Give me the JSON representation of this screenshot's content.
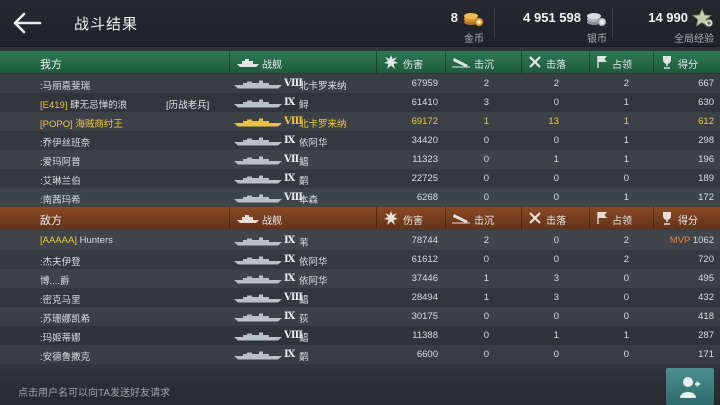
{
  "header": {
    "title": "战斗结果",
    "gold": {
      "amount": "8",
      "label": "金币"
    },
    "silver": {
      "amount": "4 951 598",
      "label": "银币"
    },
    "xp": {
      "amount": "14 990",
      "label": "全局经验"
    }
  },
  "columns": {
    "ship": "战舰",
    "damage": "伤害",
    "sunk": "击沉",
    "downed": "击落",
    "capture": "占领",
    "score": "得分"
  },
  "our_team": {
    "name": "我方",
    "rows": [
      {
        "tag": "",
        "player": ":马丽嘉斐瑞",
        "badge": "",
        "tier": "Ⅷ",
        "ship": "北卡罗来纳",
        "damage": "67959",
        "sunk": "2",
        "downed": "2",
        "capture": "2",
        "score": "667",
        "me": false
      },
      {
        "tag": "[E419]",
        "player": " 肆无忌惮的浪",
        "badge": "[历战老兵]",
        "tier": "Ⅸ",
        "ship": "鲟",
        "damage": "61410",
        "sunk": "3",
        "downed": "0",
        "capture": "1",
        "score": "630",
        "me": false
      },
      {
        "tag": "[POPO]",
        "player": " 海贼商纣王",
        "badge": "",
        "tier": "Ⅷ",
        "ship": "北卡罗来纳",
        "damage": "69172",
        "sunk": "1",
        "downed": "13",
        "capture": "1",
        "score": "612",
        "me": true
      },
      {
        "tag": "",
        "player": ":乔伊丝班奈",
        "badge": "",
        "tier": "Ⅸ",
        "ship": "依阿华",
        "damage": "34420",
        "sunk": "0",
        "downed": "0",
        "capture": "1",
        "score": "298",
        "me": false
      },
      {
        "tag": "",
        "player": ":爱玛阿普",
        "badge": "",
        "tier": "Ⅶ",
        "ship": "鲳",
        "damage": "11323",
        "sunk": "0",
        "downed": "1",
        "capture": "1",
        "score": "196",
        "me": false
      },
      {
        "tag": "",
        "player": ":艾琳兰伯",
        "badge": "",
        "tier": "Ⅸ",
        "ship": "鹬",
        "damage": "22725",
        "sunk": "0",
        "downed": "0",
        "capture": "0",
        "score": "189",
        "me": false
      },
      {
        "tag": "",
        "player": ":南茜玛希",
        "badge": "",
        "tier": "Ⅷ",
        "ship": "本森",
        "damage": "6268",
        "sunk": "0",
        "downed": "0",
        "capture": "1",
        "score": "172",
        "me": false
      }
    ]
  },
  "enemy_team": {
    "name": "敌方",
    "rows": [
      {
        "tag": "[AAAAA]",
        "player": " Hunters",
        "badge": "",
        "tier": "Ⅸ",
        "ship": "苇",
        "damage": "78744",
        "sunk": "2",
        "downed": "0",
        "capture": "2",
        "score": "1062",
        "mvp": "MVP",
        "me": false
      },
      {
        "tag": "",
        "player": ":杰夫伊登",
        "badge": "",
        "tier": "Ⅸ",
        "ship": "依阿华",
        "damage": "61612",
        "sunk": "0",
        "downed": "0",
        "capture": "2",
        "score": "720",
        "mvp": "",
        "me": false
      },
      {
        "tag": "",
        "player": "博....爵",
        "badge": "",
        "tier": "Ⅸ",
        "ship": "依阿华",
        "damage": "37446",
        "sunk": "1",
        "downed": "3",
        "capture": "0",
        "score": "495",
        "mvp": "",
        "me": false
      },
      {
        "tag": "",
        "player": ":密克马里",
        "badge": "",
        "tier": "Ⅷ",
        "ship": "鲳",
        "damage": "28494",
        "sunk": "1",
        "downed": "3",
        "capture": "0",
        "score": "432",
        "mvp": "",
        "me": false
      },
      {
        "tag": "",
        "player": ":苏珊娜凯希",
        "badge": "",
        "tier": "Ⅸ",
        "ship": "荻",
        "damage": "30175",
        "sunk": "0",
        "downed": "0",
        "capture": "0",
        "score": "418",
        "mvp": "",
        "me": false
      },
      {
        "tag": "",
        "player": ":玛姬蒂娜",
        "badge": "",
        "tier": "Ⅷ",
        "ship": "鲳",
        "damage": "11388",
        "sunk": "0",
        "downed": "1",
        "capture": "1",
        "score": "287",
        "mvp": "",
        "me": false
      },
      {
        "tag": "",
        "player": ":安德鲁撒克",
        "badge": "",
        "tier": "Ⅸ",
        "ship": "鹬",
        "damage": "6600",
        "sunk": "0",
        "downed": "0",
        "capture": "0",
        "score": "171",
        "mvp": "",
        "me": false
      }
    ]
  },
  "footer": {
    "hint": "点击用户名可以向TA发送好友请求"
  },
  "icons": {
    "back": "arrow-left-icon",
    "gold": "gold-coins-icon",
    "silver": "silver-coins-icon",
    "xp": "star-xp-icon",
    "ship": "battleship-icon",
    "damage": "explosion-icon",
    "sunk": "sinking-ship-icon",
    "downed": "crossed-planes-icon",
    "capture": "flag-icon",
    "score": "trophy-icon",
    "friend": "add-friend-icon"
  },
  "colors": {
    "our_team": "#2e7a55",
    "enemy_team": "#8a4a25",
    "highlight": "#f0c63c",
    "mvp": "#e8803a"
  }
}
